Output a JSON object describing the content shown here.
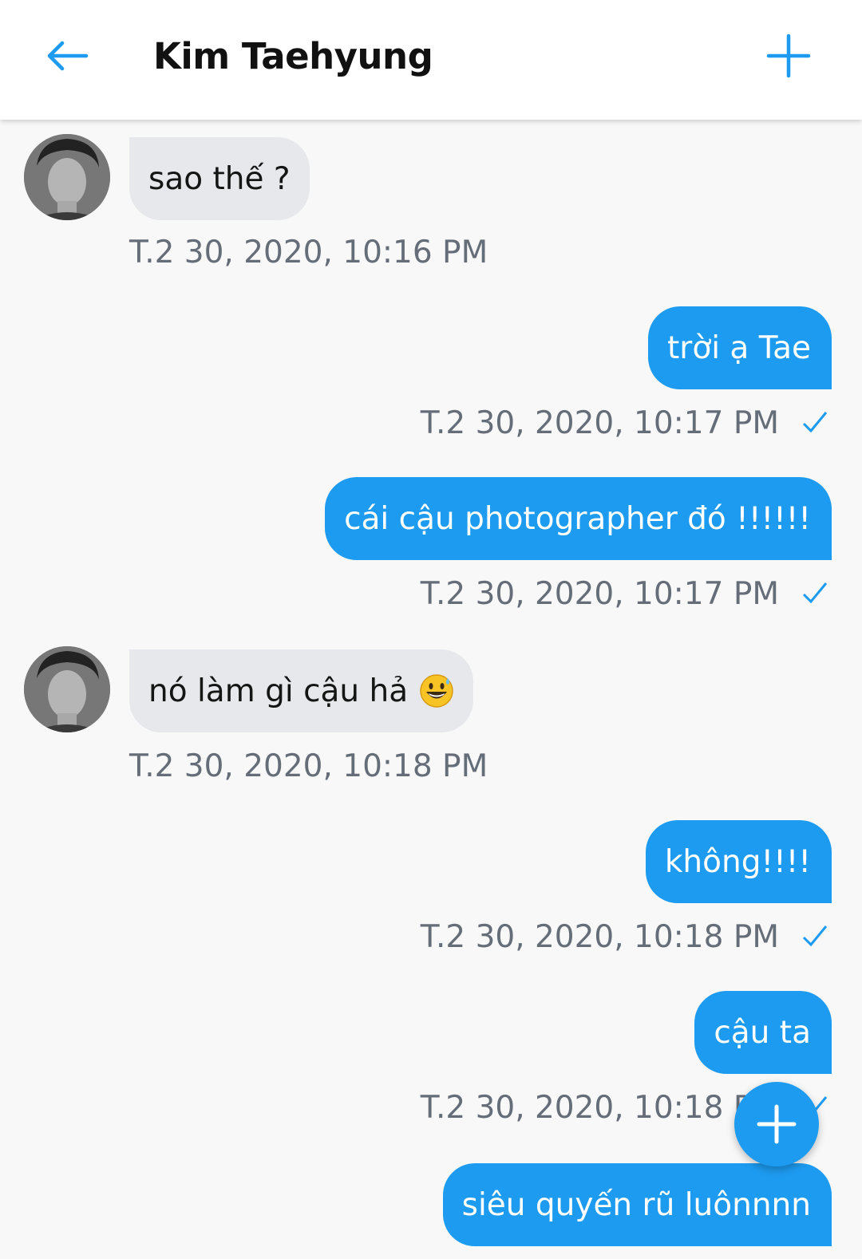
{
  "header": {
    "title": "Kim Taehyung",
    "back_icon": "arrow-left-icon",
    "add_icon": "plus-icon",
    "accent": "#1d9bf0"
  },
  "messages": [
    {
      "direction": "incoming",
      "text": "sao thế ?",
      "timestamp": "T.2 30, 2020, 10:16 PM"
    },
    {
      "direction": "outgoing",
      "text": "trời ạ Tae",
      "timestamp": "T.2 30, 2020, 10:17 PM",
      "status_icon": "check-icon"
    },
    {
      "direction": "outgoing",
      "text": "cái cậu photographer đó !!!!!!",
      "timestamp": "T.2 30, 2020, 10:17 PM",
      "status_icon": "check-icon"
    },
    {
      "direction": "incoming",
      "text": "nó làm gì cậu hả",
      "emoji": "grinning-sweat-emoji",
      "timestamp": "T.2 30, 2020, 10:18 PM"
    },
    {
      "direction": "outgoing",
      "text": "không!!!!",
      "timestamp": "T.2 30, 2020, 10:18 PM",
      "status_icon": "check-icon"
    },
    {
      "direction": "outgoing",
      "text": "cậu ta",
      "timestamp": "T.2 30, 2020, 10:18 PM",
      "status_icon": "check-icon"
    },
    {
      "direction": "outgoing",
      "text": "siêu quyến rũ luônnnn"
    }
  ],
  "fab": {
    "icon": "plus-icon"
  },
  "colors": {
    "incoming_bubble": "#e6e8ec",
    "outgoing_bubble": "#1d9bf0",
    "timestamp": "#656d78",
    "background": "#f8f8f8"
  }
}
